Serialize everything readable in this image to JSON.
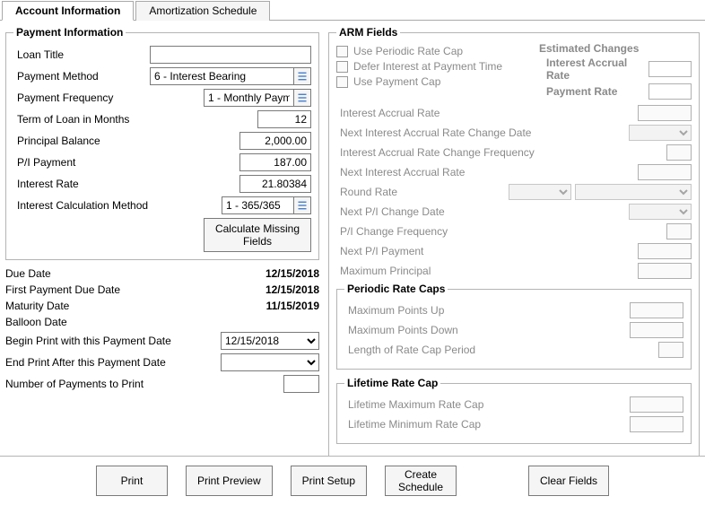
{
  "tabs": {
    "account_info": "Account Information",
    "amortization": "Amortization Schedule"
  },
  "payment_info": {
    "legend": "Payment Information",
    "loan_title_label": "Loan Title",
    "loan_title_value": "",
    "payment_method_label": "Payment Method",
    "payment_method_value": "6 - Interest Bearing",
    "payment_frequency_label": "Payment Frequency",
    "payment_frequency_value": "1 - Monthly Payme",
    "term_label": "Term of Loan in Months",
    "term_value": "12",
    "principal_label": "Principal Balance",
    "principal_value": "2,000.00",
    "pi_payment_label": "P/I Payment",
    "pi_payment_value": "187.00",
    "interest_rate_label": "Interest Rate",
    "interest_rate_value": "21.80384",
    "calc_method_label": "Interest Calculation Method",
    "calc_method_value": "1 - 365/365",
    "calc_button": "Calculate Missing Fields"
  },
  "dates": {
    "due_date_label": "Due Date",
    "due_date_value": "12/15/2018",
    "first_payment_label": "First Payment Due Date",
    "first_payment_value": "12/15/2018",
    "maturity_label": "Maturity Date",
    "maturity_value": "11/15/2019",
    "balloon_label": "Balloon Date",
    "balloon_value": "",
    "begin_print_label": "Begin Print with this Payment Date",
    "begin_print_value": "12/15/2018",
    "end_print_label": "End Print After this Payment Date",
    "end_print_value": "",
    "num_payments_label": "Number of Payments to Print",
    "num_payments_value": ""
  },
  "arm": {
    "legend": "ARM Fields",
    "use_periodic": "Use Periodic Rate Cap",
    "defer_interest": "Defer Interest at Payment Time",
    "use_payment_cap": "Use Payment Cap",
    "estimated_changes": "Estimated Changes",
    "iar_label": "Interest Accrual Rate",
    "payment_rate_label": "Payment Rate",
    "rows": {
      "interest_accrual_rate": "Interest Accrual Rate",
      "next_iar_change": "Next Interest Accrual Rate Change Date",
      "iar_change_freq": "Interest Accrual Rate Change Frequency",
      "next_iar": "Next Interest Accrual Rate",
      "round_rate": "Round Rate",
      "next_pi_change": "Next P/I Change Date",
      "pi_change_freq": "P/I Change Frequency",
      "next_pi_payment": "Next P/I Payment",
      "max_principal": "Maximum Principal"
    },
    "periodic_caps": {
      "legend": "Periodic Rate Caps",
      "max_up": "Maximum Points Up",
      "max_down": "Maximum Points Down",
      "length": "Length of Rate Cap Period"
    },
    "lifetime_cap": {
      "legend": "Lifetime Rate Cap",
      "max": "Lifetime Maximum Rate Cap",
      "min": "Lifetime Minimum Rate Cap"
    }
  },
  "buttons": {
    "print": "Print",
    "print_preview": "Print Preview",
    "print_setup": "Print Setup",
    "create_schedule": "Create\nSchedule",
    "clear_fields": "Clear Fields"
  }
}
